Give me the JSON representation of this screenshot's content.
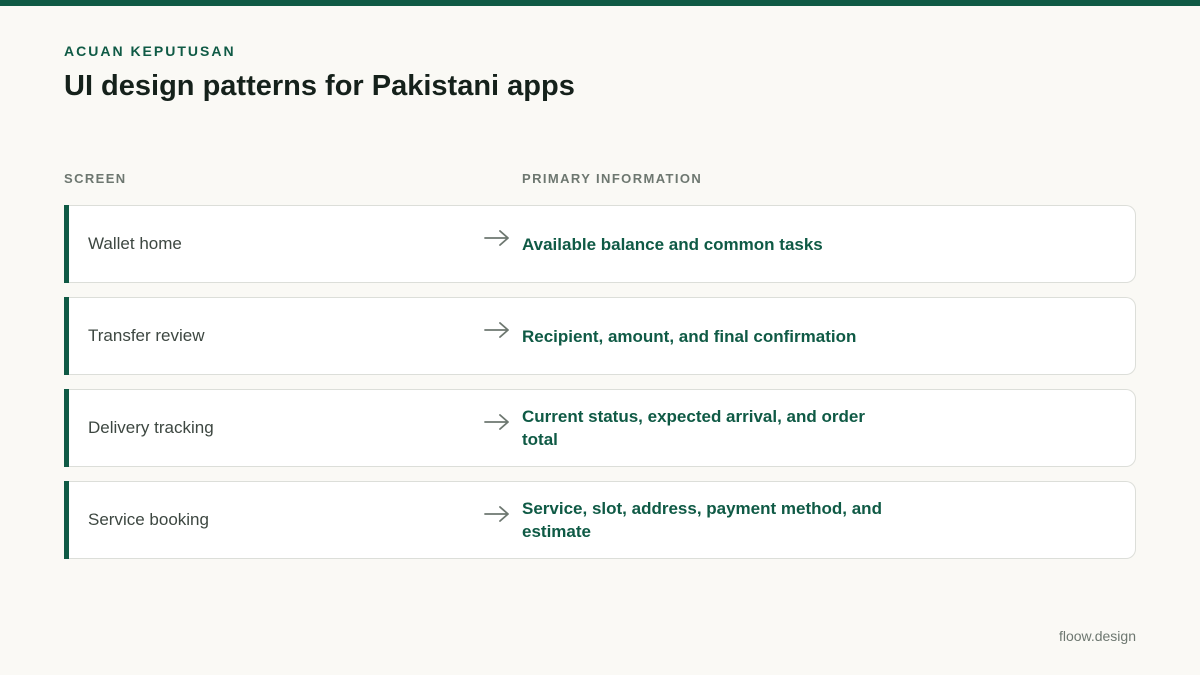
{
  "eyebrow": "ACUAN KEPUTUSAN",
  "title": "UI design patterns for Pakistani apps",
  "columns": {
    "screen": "SCREEN",
    "info": "PRIMARY INFORMATION"
  },
  "rows": [
    {
      "screen": "Wallet home",
      "info": "Available balance and common tasks"
    },
    {
      "screen": "Transfer review",
      "info": "Recipient, amount, and final confirmation"
    },
    {
      "screen": "Delivery tracking",
      "info": "Current status, expected arrival, and order total"
    },
    {
      "screen": "Service booking",
      "info": "Service, slot, address, payment method, and estimate"
    }
  ],
  "footer": "floow.design",
  "colors": {
    "accent": "#0f5a45",
    "background": "#faf9f5",
    "muted": "#6d7770"
  },
  "icons": {
    "row_arrow": "arrow-right-icon"
  }
}
